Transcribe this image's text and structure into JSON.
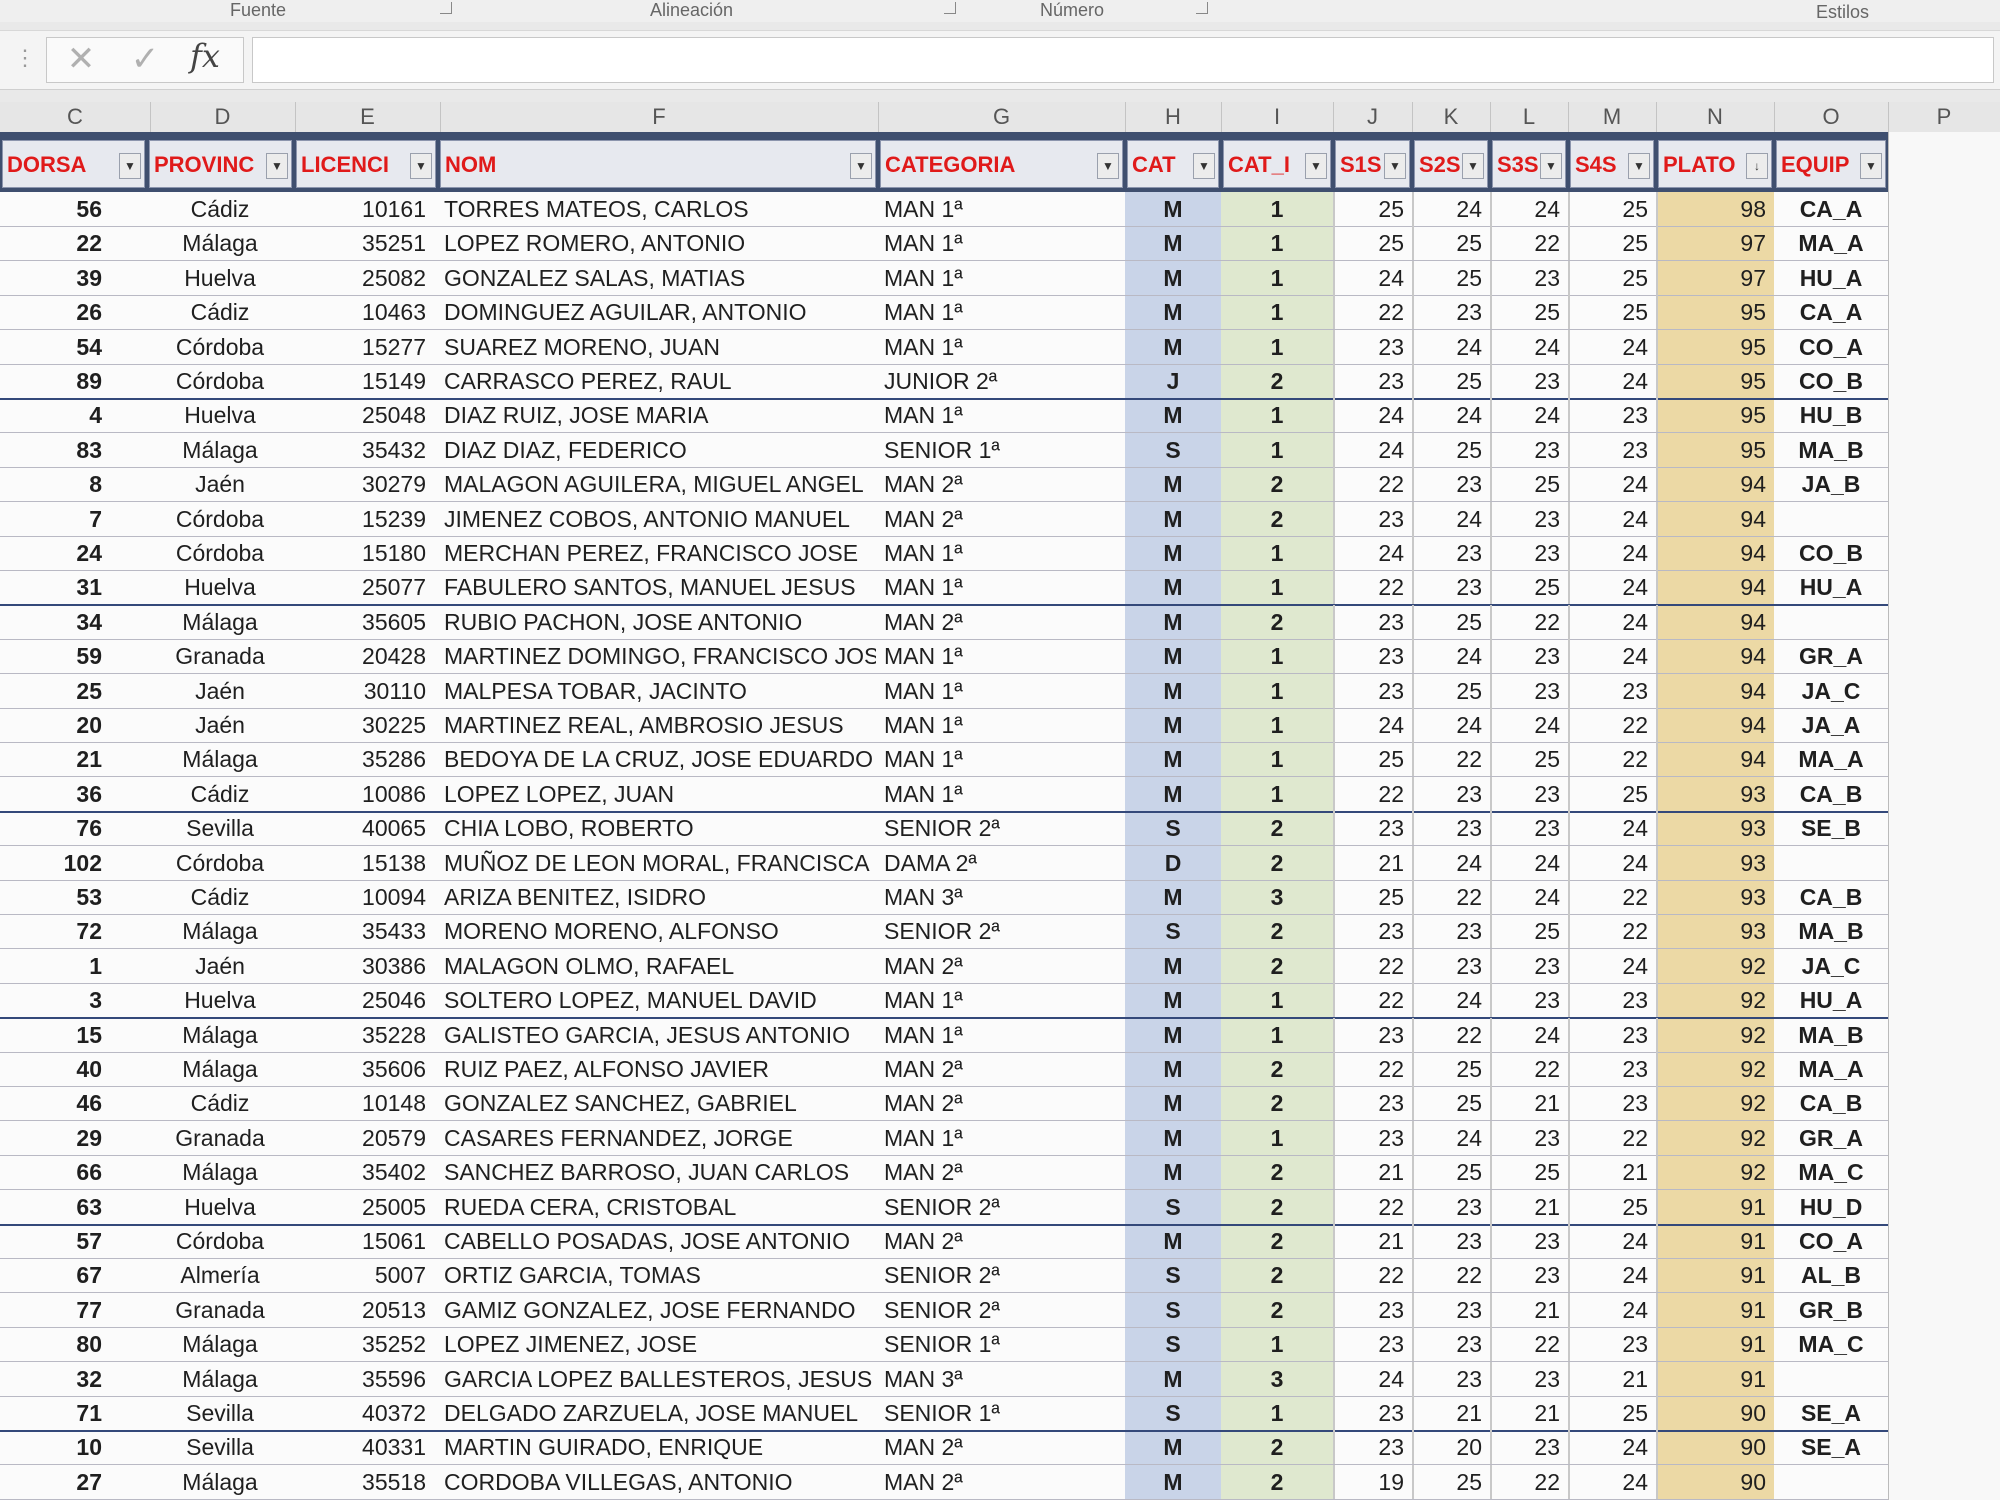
{
  "ribbon": {
    "groups": [
      "Fuente",
      "Alineación",
      "Número",
      "Estilos"
    ]
  },
  "formula_bar": {
    "cancel_icon": "x-icon",
    "enter_icon": "check-icon",
    "fx_label": "fx",
    "name_box": "",
    "content": ""
  },
  "column_letters": [
    "C",
    "D",
    "E",
    "F",
    "G",
    "H",
    "I",
    "J",
    "K",
    "L",
    "M",
    "N",
    "O",
    "P"
  ],
  "table": {
    "headers": [
      "DORSA",
      "PROVINC",
      "LICENCI",
      "NOM",
      "CATEGORIA",
      "CAT",
      "CAT_I",
      "S1S",
      "S2S",
      "S3S",
      "S4S",
      "PLATO",
      "EQUIP"
    ],
    "sorted_column": "PLATO",
    "rows": [
      [
        "56",
        "Cádiz",
        "10161",
        "TORRES MATEOS, CARLOS",
        "MAN 1ª",
        "M",
        "1",
        "25",
        "24",
        "24",
        "25",
        "98",
        "CA_A"
      ],
      [
        "22",
        "Málaga",
        "35251",
        "LOPEZ ROMERO, ANTONIO",
        "MAN 1ª",
        "M",
        "1",
        "25",
        "25",
        "22",
        "25",
        "97",
        "MA_A"
      ],
      [
        "39",
        "Huelva",
        "25082",
        "GONZALEZ SALAS, MATIAS",
        "MAN 1ª",
        "M",
        "1",
        "24",
        "25",
        "23",
        "25",
        "97",
        "HU_A"
      ],
      [
        "26",
        "Cádiz",
        "10463",
        "DOMINGUEZ AGUILAR, ANTONIO",
        "MAN 1ª",
        "M",
        "1",
        "22",
        "23",
        "25",
        "25",
        "95",
        "CA_A"
      ],
      [
        "54",
        "Córdoba",
        "15277",
        "SUAREZ MORENO, JUAN",
        "MAN 1ª",
        "M",
        "1",
        "23",
        "24",
        "24",
        "24",
        "95",
        "CO_A"
      ],
      [
        "89",
        "Córdoba",
        "15149",
        "CARRASCO PEREZ, RAUL",
        "JUNIOR 2ª",
        "J",
        "2",
        "23",
        "25",
        "23",
        "24",
        "95",
        "CO_B"
      ],
      [
        "4",
        "Huelva",
        "25048",
        "DIAZ RUIZ, JOSE MARIA",
        "MAN 1ª",
        "M",
        "1",
        "24",
        "24",
        "24",
        "23",
        "95",
        "HU_B"
      ],
      [
        "83",
        "Málaga",
        "35432",
        "DIAZ DIAZ, FEDERICO",
        "SENIOR 1ª",
        "S",
        "1",
        "24",
        "25",
        "23",
        "23",
        "95",
        "MA_B"
      ],
      [
        "8",
        "Jaén",
        "30279",
        "MALAGON AGUILERA, MIGUEL ANGEL",
        "MAN 2ª",
        "M",
        "2",
        "22",
        "23",
        "25",
        "24",
        "94",
        "JA_B"
      ],
      [
        "7",
        "Córdoba",
        "15239",
        "JIMENEZ COBOS, ANTONIO  MANUEL",
        "MAN 2ª",
        "M",
        "2",
        "23",
        "24",
        "23",
        "24",
        "94",
        ""
      ],
      [
        "24",
        "Córdoba",
        "15180",
        "MERCHAN PEREZ, FRANCISCO JOSE",
        "MAN 1ª",
        "M",
        "1",
        "24",
        "23",
        "23",
        "24",
        "94",
        "CO_B"
      ],
      [
        "31",
        "Huelva",
        "25077",
        "FABULERO SANTOS, MANUEL JESUS",
        "MAN 1ª",
        "M",
        "1",
        "22",
        "23",
        "25",
        "24",
        "94",
        "HU_A"
      ],
      [
        "34",
        "Málaga",
        "35605",
        "RUBIO PACHON, JOSE ANTONIO",
        "MAN 2ª",
        "M",
        "2",
        "23",
        "25",
        "22",
        "24",
        "94",
        ""
      ],
      [
        "59",
        "Granada",
        "20428",
        "MARTINEZ DOMINGO, FRANCISCO JOSE",
        "MAN 1ª",
        "M",
        "1",
        "23",
        "24",
        "23",
        "24",
        "94",
        "GR_A"
      ],
      [
        "25",
        "Jaén",
        "30110",
        "MALPESA TOBAR, JACINTO",
        "MAN 1ª",
        "M",
        "1",
        "23",
        "25",
        "23",
        "23",
        "94",
        "JA_C"
      ],
      [
        "20",
        "Jaén",
        "30225",
        "MARTINEZ REAL, AMBROSIO JESUS",
        "MAN 1ª",
        "M",
        "1",
        "24",
        "24",
        "24",
        "22",
        "94",
        "JA_A"
      ],
      [
        "21",
        "Málaga",
        "35286",
        "BEDOYA DE LA CRUZ, JOSE EDUARDO",
        "MAN 1ª",
        "M",
        "1",
        "25",
        "22",
        "25",
        "22",
        "94",
        "MA_A"
      ],
      [
        "36",
        "Cádiz",
        "10086",
        "LOPEZ LOPEZ, JUAN",
        "MAN 1ª",
        "M",
        "1",
        "22",
        "23",
        "23",
        "25",
        "93",
        "CA_B"
      ],
      [
        "76",
        "Sevilla",
        "40065",
        "CHIA LOBO, ROBERTO",
        "SENIOR 2ª",
        "S",
        "2",
        "23",
        "23",
        "23",
        "24",
        "93",
        "SE_B"
      ],
      [
        "102",
        "Córdoba",
        "15138",
        "MUÑOZ DE LEON MORAL, FRANCISCA",
        "DAMA 2ª",
        "D",
        "2",
        "21",
        "24",
        "24",
        "24",
        "93",
        ""
      ],
      [
        "53",
        "Cádiz",
        "10094",
        "ARIZA BENITEZ, ISIDRO",
        "MAN 3ª",
        "M",
        "3",
        "25",
        "22",
        "24",
        "22",
        "93",
        "CA_B"
      ],
      [
        "72",
        "Málaga",
        "35433",
        "MORENO MORENO, ALFONSO",
        "SENIOR 2ª",
        "S",
        "2",
        "23",
        "23",
        "25",
        "22",
        "93",
        "MA_B"
      ],
      [
        "1",
        "Jaén",
        "30386",
        "MALAGON OLMO, RAFAEL",
        "MAN 2ª",
        "M",
        "2",
        "22",
        "23",
        "23",
        "24",
        "92",
        "JA_C"
      ],
      [
        "3",
        "Huelva",
        "25046",
        "SOLTERO LOPEZ, MANUEL DAVID",
        "MAN 1ª",
        "M",
        "1",
        "22",
        "24",
        "23",
        "23",
        "92",
        "HU_A"
      ],
      [
        "15",
        "Málaga",
        "35228",
        "GALISTEO GARCIA, JESUS ANTONIO",
        "MAN 1ª",
        "M",
        "1",
        "23",
        "22",
        "24",
        "23",
        "92",
        "MA_B"
      ],
      [
        "40",
        "Málaga",
        "35606",
        "RUIZ PAEZ, ALFONSO JAVIER",
        "MAN 2ª",
        "M",
        "2",
        "22",
        "25",
        "22",
        "23",
        "92",
        "MA_A"
      ],
      [
        "46",
        "Cádiz",
        "10148",
        "GONZALEZ SANCHEZ, GABRIEL",
        "MAN 2ª",
        "M",
        "2",
        "23",
        "25",
        "21",
        "23",
        "92",
        "CA_B"
      ],
      [
        "29",
        "Granada",
        "20579",
        "CASARES FERNANDEZ, JORGE",
        "MAN 1ª",
        "M",
        "1",
        "23",
        "24",
        "23",
        "22",
        "92",
        "GR_A"
      ],
      [
        "66",
        "Málaga",
        "35402",
        "SANCHEZ BARROSO, JUAN CARLOS",
        "MAN 2ª",
        "M",
        "2",
        "21",
        "25",
        "25",
        "21",
        "92",
        "MA_C"
      ],
      [
        "63",
        "Huelva",
        "25005",
        "RUEDA CERA, CRISTOBAL",
        "SENIOR 2ª",
        "S",
        "2",
        "22",
        "23",
        "21",
        "25",
        "91",
        "HU_D"
      ],
      [
        "57",
        "Córdoba",
        "15061",
        "CABELLO POSADAS, JOSE ANTONIO",
        "MAN 2ª",
        "M",
        "2",
        "21",
        "23",
        "23",
        "24",
        "91",
        "CO_A"
      ],
      [
        "67",
        "Almería",
        "5007",
        "ORTIZ GARCIA, TOMAS",
        "SENIOR 2ª",
        "S",
        "2",
        "22",
        "22",
        "23",
        "24",
        "91",
        "AL_B"
      ],
      [
        "77",
        "Granada",
        "20513",
        "GAMIZ GONZALEZ, JOSE FERNANDO",
        "SENIOR 2ª",
        "S",
        "2",
        "23",
        "23",
        "21",
        "24",
        "91",
        "GR_B"
      ],
      [
        "80",
        "Málaga",
        "35252",
        "LOPEZ JIMENEZ, JOSE",
        "SENIOR 1ª",
        "S",
        "1",
        "23",
        "23",
        "22",
        "23",
        "91",
        "MA_C"
      ],
      [
        "32",
        "Málaga",
        "35596",
        "GARCIA LOPEZ BALLESTEROS, JESUS E",
        "MAN 3ª",
        "M",
        "3",
        "24",
        "23",
        "23",
        "21",
        "91",
        ""
      ],
      [
        "71",
        "Sevilla",
        "40372",
        "DELGADO ZARZUELA, JOSE MANUEL",
        "SENIOR 1ª",
        "S",
        "1",
        "23",
        "21",
        "21",
        "25",
        "90",
        "SE_A"
      ],
      [
        "10",
        "Sevilla",
        "40331",
        "MARTIN GUIRADO, ENRIQUE",
        "MAN 2ª",
        "M",
        "2",
        "23",
        "20",
        "23",
        "24",
        "90",
        "SE_A"
      ],
      [
        "27",
        "Málaga",
        "35518",
        "CORDOBA VILLEGAS, ANTONIO",
        "MAN 2ª",
        "M",
        "2",
        "19",
        "25",
        "22",
        "24",
        "90",
        ""
      ]
    ],
    "group_end_rows": [
      5,
      11,
      17,
      23,
      29,
      35
    ]
  },
  "colors": {
    "header_band": "#3f4f6f",
    "header_text": "#e01a1a",
    "cat_column": "#c9d4e8",
    "cat2_column": "#dfe8cf",
    "plato_column": "#ecd9a5",
    "group_border": "#34497a"
  }
}
